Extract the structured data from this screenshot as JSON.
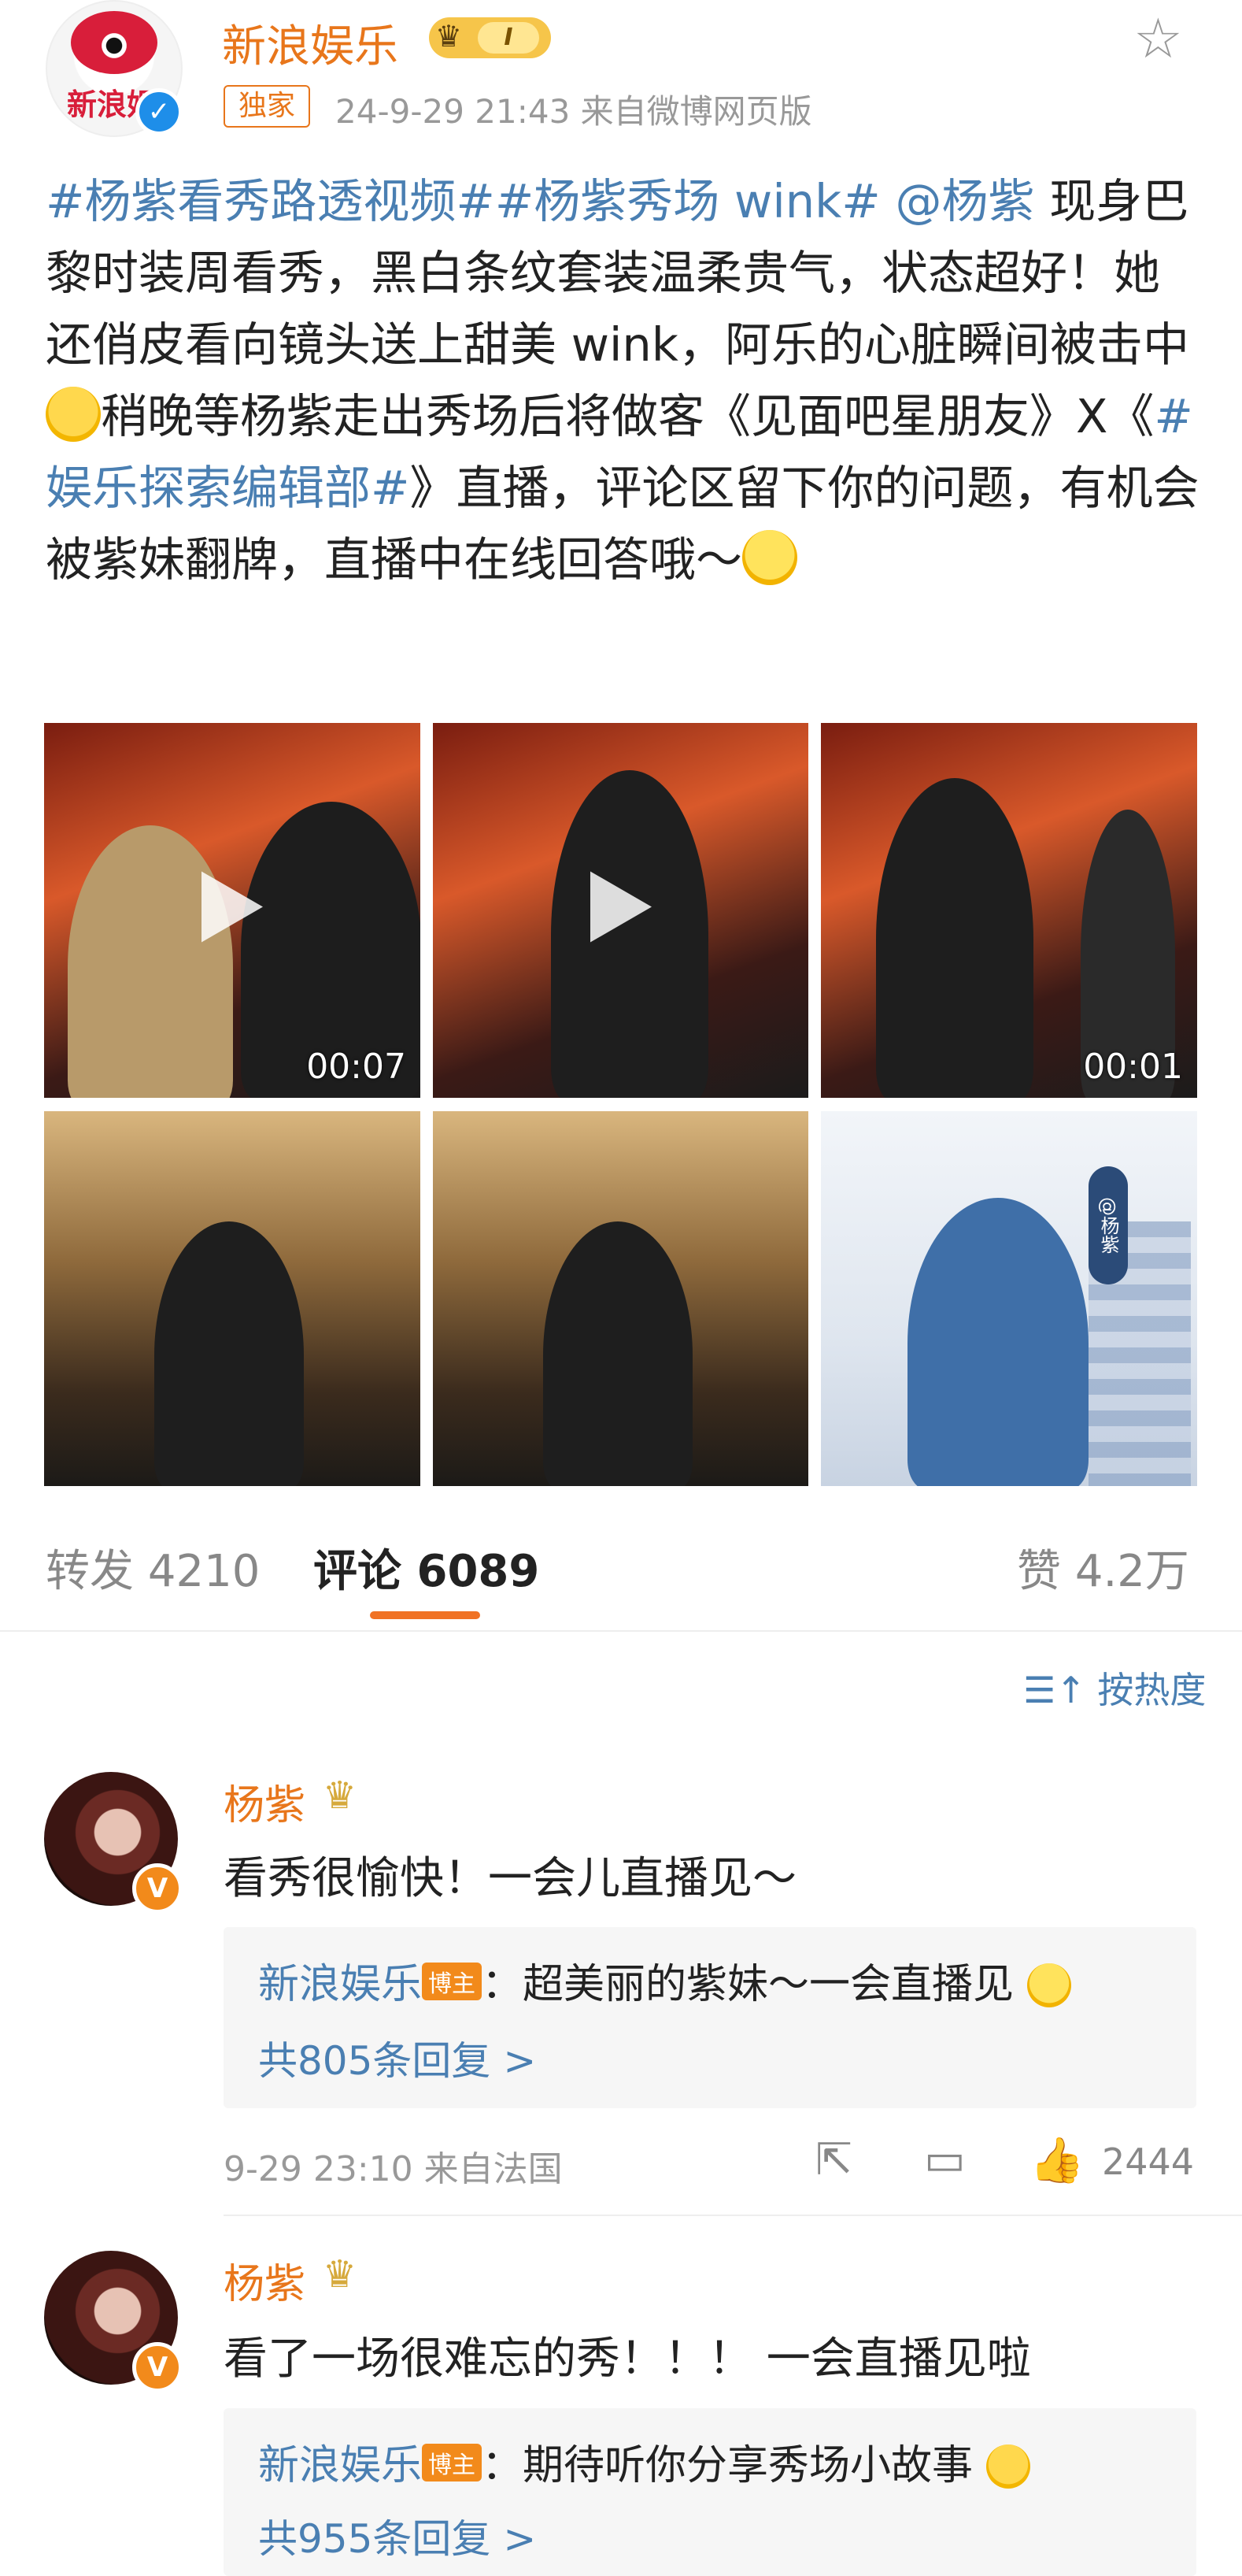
{
  "post": {
    "author": "新浪娱乐",
    "avatar_logo_text": "新浪娱",
    "level_badge": "I",
    "exclusive_tag": "独家",
    "meta": "24-9-29 21:43  来自微博网页版",
    "text_parts": {
      "link1": "#杨紫看秀路透视频##杨紫秀场 wink#",
      "mention": "@杨紫",
      "t1": " 现身巴黎时装周看秀，黑白条纹套装温柔贵气，状态超好！她还俏皮看向镜头送上甜美 wink，阿乐的心脏瞬间被击中",
      "t2": "稍晚等杨紫走出秀场后将做客《见面吧星朋友》X《",
      "link2": "#娱乐探索编辑部#",
      "t3": "》直播，评论区留下你的问题，有机会被紫妹翻牌，直播中在线回答哦～"
    },
    "media": [
      {
        "type": "video",
        "duration": "00:07"
      },
      {
        "type": "video",
        "duration": ""
      },
      {
        "type": "video",
        "duration": "00:01"
      },
      {
        "type": "image"
      },
      {
        "type": "image"
      },
      {
        "type": "image",
        "overlay_text": "@杨紫"
      }
    ]
  },
  "stats": {
    "repost_label": "转发",
    "repost_count": "4210",
    "comment_label": "评论",
    "comment_count": "6089",
    "like_label": "赞",
    "like_count": "4.2万"
  },
  "sort_label": "按热度",
  "comments": [
    {
      "name": "杨紫",
      "text": "看秀很愉快！一会儿直播见～",
      "reply_author": "新浪娱乐",
      "reply_tag": "博主",
      "reply_text": "：超美丽的紫妹～一会直播见",
      "reply_more": "共805条回复 >",
      "meta": "9-29 23:10  来自法国",
      "likes": "2444"
    },
    {
      "name": "杨紫",
      "text": "看了一场很难忘的秀！！！ 一会直播见啦",
      "reply_author": "新浪娱乐",
      "reply_tag": "博主",
      "reply_text": "：期待听你分享秀场小故事",
      "reply_more": "共955条回复 >"
    }
  ]
}
